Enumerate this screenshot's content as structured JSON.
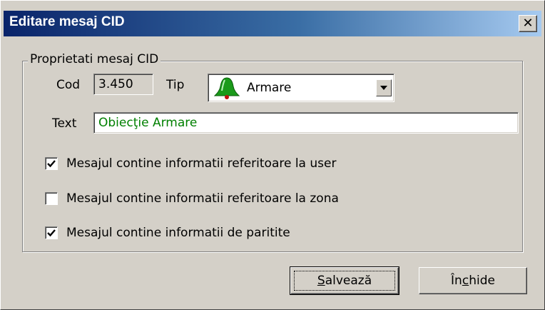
{
  "window": {
    "title": "Editare mesaj CID",
    "close_glyph": "✕"
  },
  "group": {
    "label": "Proprietati mesaj CID"
  },
  "fields": {
    "cod_label": "Cod",
    "cod_value": "3.450",
    "tip_label": "Tip",
    "tip_value": "Armare",
    "tip_icon": "bell-icon",
    "text_label": "Text",
    "text_value": "Obiecţie Armare",
    "text_color": "#008000"
  },
  "checkboxes": [
    {
      "label": "Mesajul contine informatii referitoare la user",
      "checked": true
    },
    {
      "label": "Mesajul contine informatii referitoare la zona",
      "checked": false
    },
    {
      "label": "Mesajul contine informatii de paritite",
      "checked": true
    }
  ],
  "buttons": {
    "save": {
      "label_pre": "",
      "label_key": "S",
      "label_post": "alvează"
    },
    "close": {
      "label_pre": "În",
      "label_key": "c",
      "label_post": "hide"
    }
  },
  "colors": {
    "titlebar_start": "#0a246a",
    "titlebar_end": "#a6caf0",
    "face": "#d4d0c8",
    "bell": "#1a9a1a"
  }
}
